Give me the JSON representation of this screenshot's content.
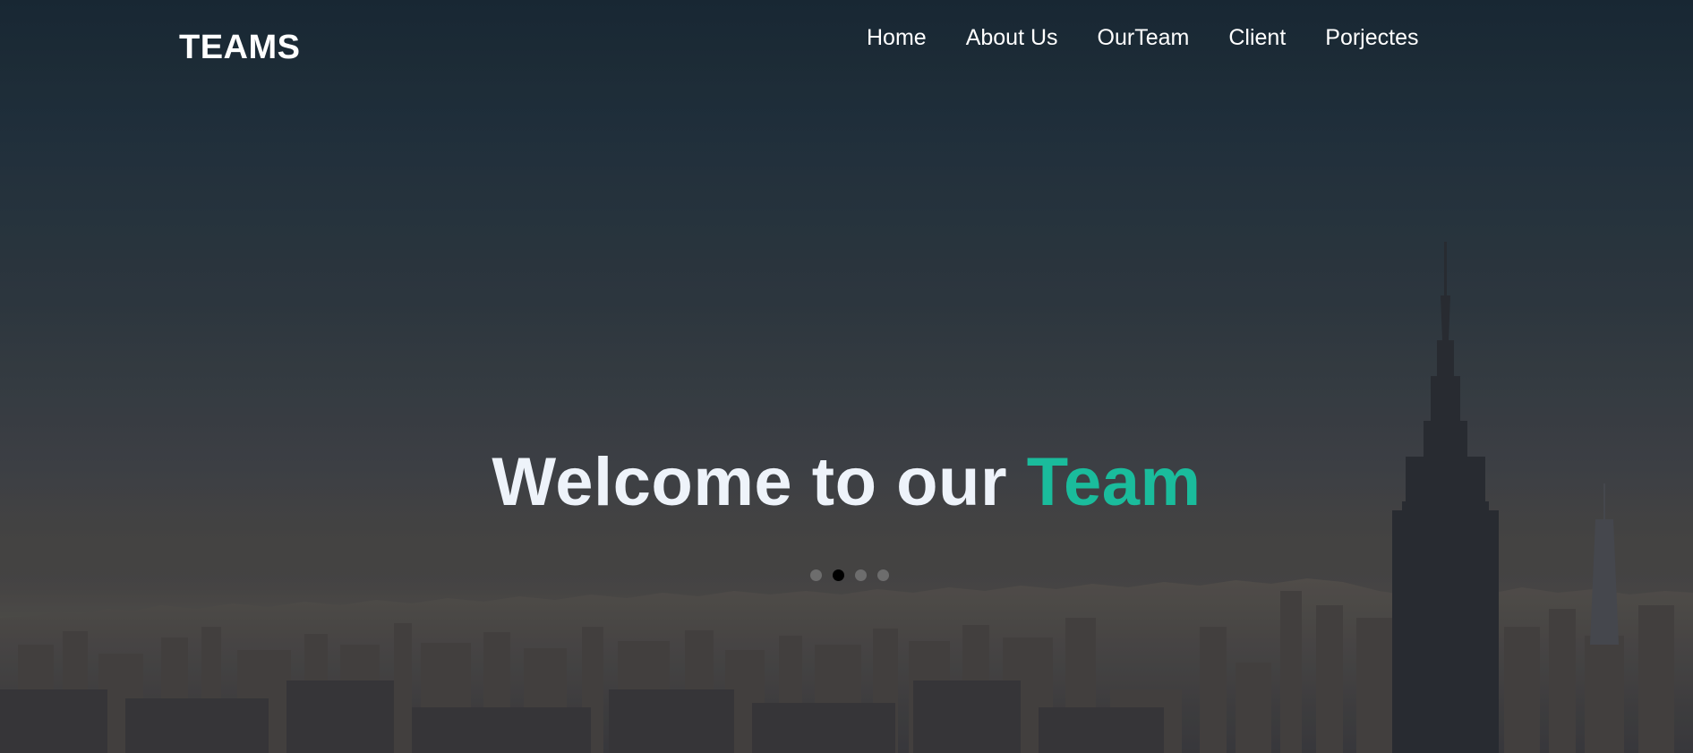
{
  "navbar": {
    "brand": "TEAMS",
    "links": [
      {
        "label": "Home"
      },
      {
        "label": "About Us"
      },
      {
        "label": "OurTeam"
      },
      {
        "label": "Client"
      },
      {
        "label": "Porjectes"
      }
    ]
  },
  "hero": {
    "headline_main": "Welcome to our",
    "headline_accent": "Team",
    "accent_color": "#1abc9c",
    "carousel": {
      "slide_count": 4,
      "active_index": 1
    }
  },
  "background": {
    "scene": "city-skyline-image"
  }
}
